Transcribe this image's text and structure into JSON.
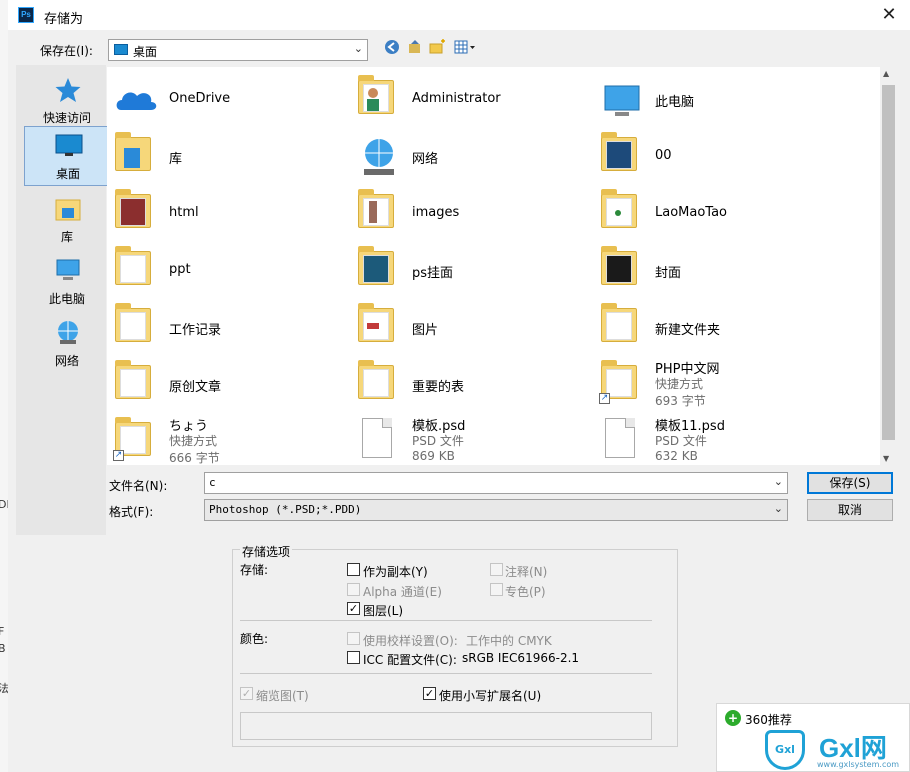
{
  "window": {
    "title": "存储为",
    "app_icon": "Ps",
    "close_glyph": "✕"
  },
  "save_in": {
    "label": "保存在(I):",
    "value": "桌面"
  },
  "places": [
    {
      "label": "快速访问",
      "icon": "star-icon"
    },
    {
      "label": "桌面",
      "icon": "desktop-icon",
      "selected": true
    },
    {
      "label": "库",
      "icon": "library-icon"
    },
    {
      "label": "此电脑",
      "icon": "computer-icon"
    },
    {
      "label": "网络",
      "icon": "network-icon"
    }
  ],
  "files": [
    {
      "name": "OneDrive",
      "kind": "onedrive"
    },
    {
      "name": "Administrator",
      "kind": "user-folder"
    },
    {
      "name": "此电脑",
      "kind": "computer"
    },
    {
      "name": "库",
      "kind": "library"
    },
    {
      "name": "网络",
      "kind": "network"
    },
    {
      "name": "00",
      "kind": "folder"
    },
    {
      "name": "html",
      "kind": "folder"
    },
    {
      "name": "images",
      "kind": "folder"
    },
    {
      "name": "LaoMaoTao",
      "kind": "folder"
    },
    {
      "name": "ppt",
      "kind": "folder"
    },
    {
      "name": "ps挂面",
      "kind": "folder"
    },
    {
      "name": "封面",
      "kind": "folder"
    },
    {
      "name": "工作记录",
      "kind": "folder"
    },
    {
      "name": "图片",
      "kind": "folder"
    },
    {
      "name": "新建文件夹",
      "kind": "folder"
    },
    {
      "name": "原创文章",
      "kind": "folder"
    },
    {
      "name": "重要的表",
      "kind": "folder"
    },
    {
      "name": "PHP中文网",
      "kind": "shortcut",
      "type": "快捷方式",
      "size": "693 字节"
    },
    {
      "name": "ちょう",
      "kind": "shortcut",
      "type": "快捷方式",
      "size": "666 字节"
    },
    {
      "name": "模板.psd",
      "kind": "psd",
      "type": "PSD 文件",
      "size": "869 KB"
    },
    {
      "name": "模板11.psd",
      "kind": "psd",
      "type": "PSD 文件",
      "size": "632 KB"
    }
  ],
  "filename": {
    "label": "文件名(N):",
    "value": "c"
  },
  "format": {
    "label": "格式(F):",
    "value": "Photoshop (*.PSD;*.PDD)"
  },
  "buttons": {
    "save": "保存(S)",
    "cancel": "取消"
  },
  "options": {
    "group_title": "存储选项",
    "save_label": "存储:",
    "as_copy": "作为副本(Y)",
    "notes": "注释(N)",
    "alpha": "Alpha 通道(E)",
    "spot": "专色(P)",
    "layers": "图层(L)",
    "color_label": "颜色:",
    "proof": "使用校样设置(O):",
    "proof_value": "工作中的 CMYK",
    "icc": "ICC 配置文件(C):",
    "icc_value": "sRGB IEC61966-2.1",
    "thumbnail": "缩览图(T)",
    "lowercase_ext": "使用小写扩展名(U)"
  },
  "toast": {
    "title": "360推荐",
    "brand": "Gxl网",
    "shield": "Gxl",
    "url": "www.gxlsystem.com"
  },
  "colors": {
    "accent": "#0078d7",
    "folder": "#f6d77a",
    "selected": "#cce4f7"
  }
}
